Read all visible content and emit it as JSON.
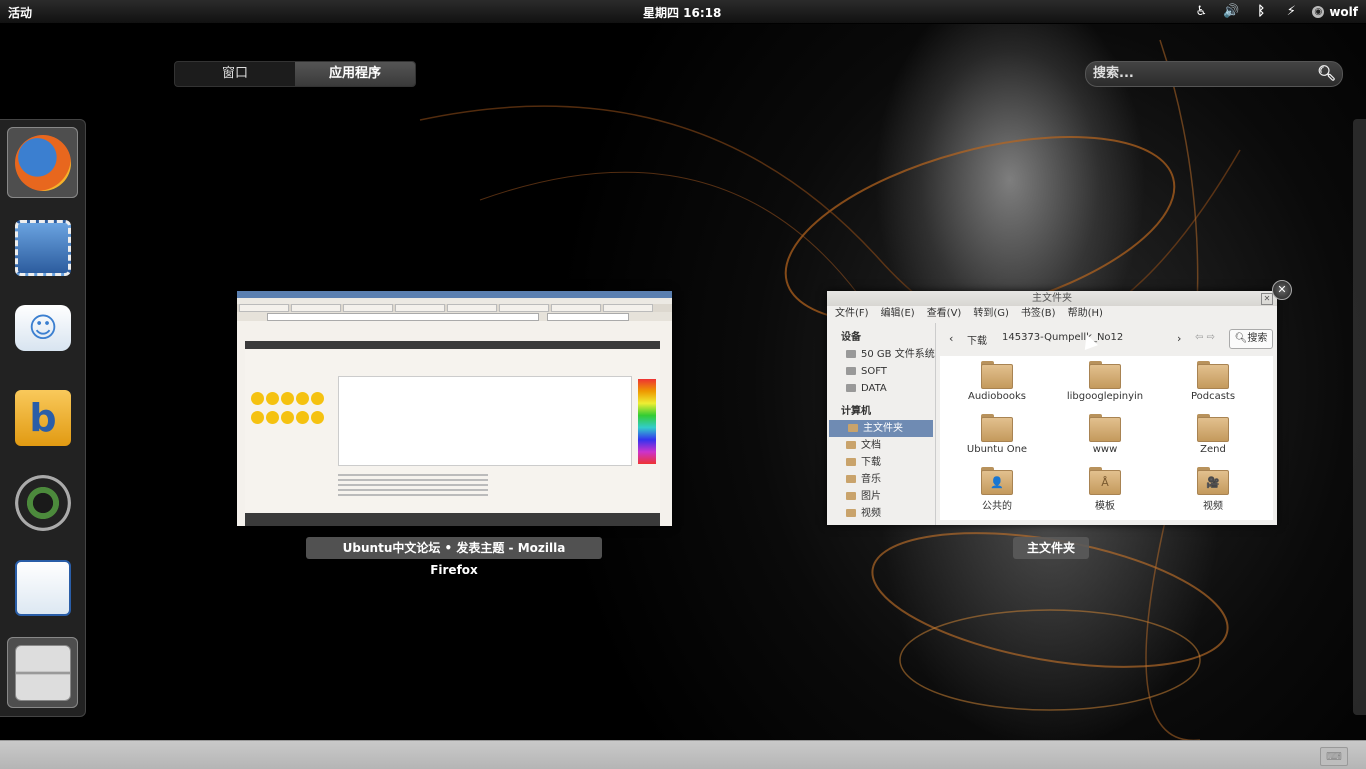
{
  "top_panel": {
    "activities": "活动",
    "clock": "星期四 16:18",
    "user": "wolf",
    "tray_icons": [
      "accessibility-icon",
      "volume-icon",
      "bluetooth-icon",
      "network-icon"
    ]
  },
  "view_tabs": {
    "windows": "窗口",
    "applications": "应用程序",
    "active": "applications"
  },
  "search": {
    "placeholder": "搜索..."
  },
  "dash": {
    "items": [
      {
        "name": "firefox",
        "icon": "firefox-icon",
        "running": true
      },
      {
        "name": "evolution",
        "icon": "mail-stamp-icon",
        "running": false
      },
      {
        "name": "empathy",
        "icon": "chat-bubble-icon",
        "running": false
      },
      {
        "name": "banshee",
        "icon": "banshee-icon",
        "running": false
      },
      {
        "name": "cheese",
        "icon": "camera-lens-icon",
        "running": false
      },
      {
        "name": "writer",
        "icon": "document-icon",
        "running": false
      },
      {
        "name": "file-manager",
        "icon": "file-cabinet-icon",
        "running": true
      }
    ]
  },
  "windows": {
    "firefox": {
      "caption": "Ubuntu中文论坛 • 发表主题 - Mozilla Firefox"
    },
    "nautilus": {
      "title": "主文件夹",
      "caption": "主文件夹",
      "menu": [
        "文件(F)",
        "编辑(E)",
        "查看(V)",
        "转到(G)",
        "书签(B)",
        "帮助(H)"
      ],
      "sidebar": {
        "devices_header": "设备",
        "devices": [
          "50 GB 文件系统",
          "SOFT",
          "DATA"
        ],
        "computer_header": "计算机",
        "places": [
          "主文件夹",
          "文档",
          "下载",
          "音乐",
          "图片",
          "视频"
        ],
        "selected": "主文件夹"
      },
      "path": {
        "crumbs": [
          "下载",
          "145373-Qumpellk_No12"
        ],
        "search_label": "搜索"
      },
      "files": [
        {
          "name": "Audiobooks",
          "emblem": ""
        },
        {
          "name": "libgooglepinyin",
          "emblem": ""
        },
        {
          "name": "Podcasts",
          "emblem": ""
        },
        {
          "name": "Ubuntu One",
          "emblem": ""
        },
        {
          "name": "www",
          "emblem": ""
        },
        {
          "name": "Zend",
          "emblem": ""
        },
        {
          "name": "公共的",
          "emblem": "👤"
        },
        {
          "name": "模板",
          "emblem": "Å"
        },
        {
          "name": "视频",
          "emblem": "🎥"
        }
      ]
    }
  }
}
